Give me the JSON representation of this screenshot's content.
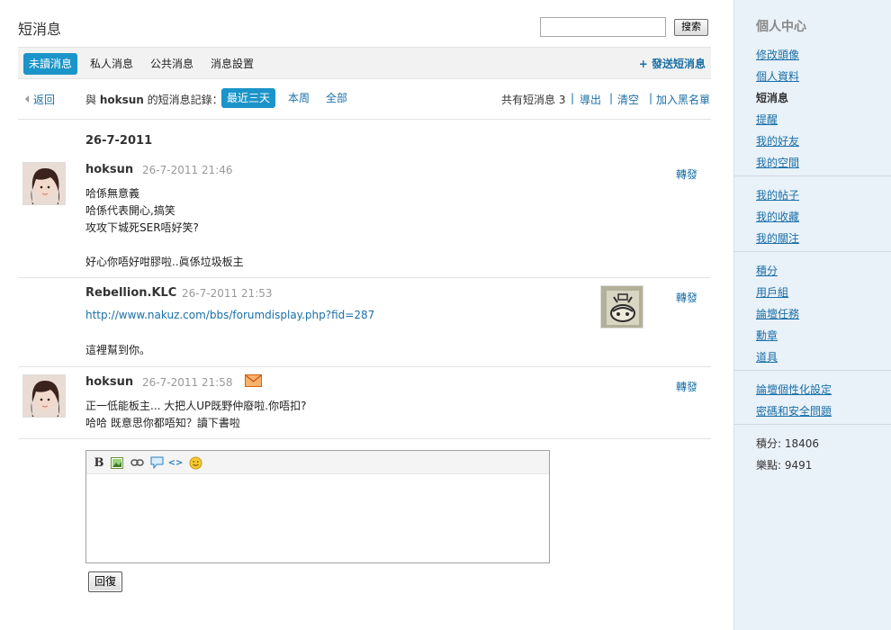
{
  "header": {
    "title": "短消息",
    "search_placeholder": "",
    "search_button": "搜索"
  },
  "tabs": [
    {
      "label": "未讀消息",
      "active": true
    },
    {
      "label": "私人消息",
      "active": false
    },
    {
      "label": "公共消息",
      "active": false
    },
    {
      "label": "消息設置",
      "active": false
    }
  ],
  "send_message": "+ 發送短消息",
  "filter": {
    "back": "返回",
    "label_prefix": "與",
    "username": "hoksun",
    "label_suffix": "的短消息記錄：",
    "ranges": [
      "最近三天",
      "本周",
      "全部"
    ],
    "count_text": "共有短消息 3",
    "actions": [
      "導出",
      "清空",
      "加入黑名單"
    ]
  },
  "conversation": {
    "date": "26-7-2011",
    "forward_label": "轉發",
    "messages": [
      {
        "sender": "hoksun",
        "time": "26-7-2011 21:46",
        "lines": [
          "哈係無意義",
          "哈係代表開心,搞笑",
          "攻攻下城死SER唔好笑?",
          "",
          "好心你唔好咁膠啦..眞係垃圾板主"
        ]
      },
      {
        "sender": "Rebellion.KLC",
        "time": "26-7-2011 21:53",
        "link": "http://www.nakuz.com/bbs/forumdisplay.php?fid=287",
        "lines": [
          "這裡幫到你。"
        ]
      },
      {
        "sender": "hoksun",
        "time": "26-7-2011 21:58",
        "lines": [
          "正一低能板主... 大把人UP既野仲廢啦.你唔扣?",
          "哈哈 既意思你都唔知？讀下書啦"
        ]
      }
    ]
  },
  "editor": {
    "toolbar_icons": [
      "bold-icon",
      "image-icon",
      "link-icon",
      "quote-icon",
      "code-icon",
      "smiley-icon"
    ],
    "bold_glyph": "B",
    "code_glyph": "<>",
    "reply_button": "回復"
  },
  "sidebar": {
    "title": "個人中心",
    "group1": [
      "修改頭像",
      "個人資料",
      "短消息",
      "提醒",
      "我的好友",
      "我的空間"
    ],
    "current": "短消息",
    "group2": [
      "我的帖子",
      "我的收藏",
      "我的關注"
    ],
    "group3": [
      "積分",
      "用戶組",
      "論壇任務",
      "勳章",
      "道具"
    ],
    "group4": [
      "論壇個性化設定",
      "密碼和安全問題"
    ],
    "stats": [
      "積分: 18406",
      "樂點: 9491"
    ]
  },
  "colors": {
    "accent": "#1b94c9",
    "link": "#1a6fa6",
    "sidebar_bg": "#e9f1f9"
  }
}
